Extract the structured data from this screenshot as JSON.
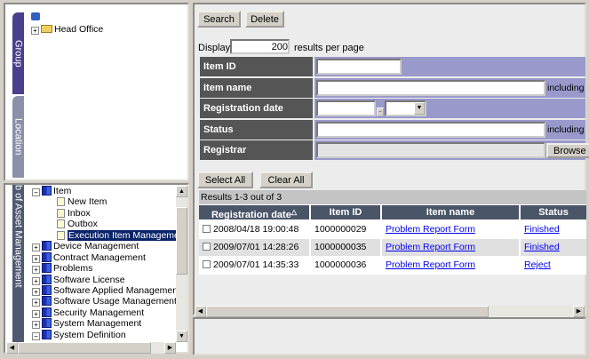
{
  "left": {
    "tabs": [
      "Group",
      "Location",
      "b of Asset Management"
    ],
    "group_tree": {
      "root_icon": "network-computer-icon",
      "items": [
        {
          "label": "Head Office",
          "icon": "folder-icon",
          "expanded": false
        }
      ]
    },
    "menu_tree": [
      {
        "label": "Item",
        "level": 0,
        "expanded": true
      },
      {
        "label": "New Item",
        "level": 1
      },
      {
        "label": "Inbox",
        "level": 1
      },
      {
        "label": "Outbox",
        "level": 1
      },
      {
        "label": "Execution Item Management",
        "level": 1,
        "selected": true
      },
      {
        "label": "Device Management",
        "level": 0
      },
      {
        "label": "Contract Management",
        "level": 0
      },
      {
        "label": "Problems",
        "level": 0
      },
      {
        "label": "Software License",
        "level": 0
      },
      {
        "label": "Software Applied Management",
        "level": 0
      },
      {
        "label": "Software Usage Management",
        "level": 0
      },
      {
        "label": "Security Management",
        "level": 0
      },
      {
        "label": "System Management",
        "level": 0
      },
      {
        "label": "System Definition",
        "level": 0,
        "expanded": true
      }
    ]
  },
  "toolbar": {
    "search": "Search",
    "delete": "Delete"
  },
  "display": {
    "prefix": "Display",
    "value": "200",
    "suffix": "results per page"
  },
  "form": {
    "item_id": "Item ID",
    "item_name": "Item name",
    "reg_date": "Registration date",
    "status": "Status",
    "registrar": "Registrar",
    "including": "including",
    "browse": "Browse"
  },
  "actions": {
    "select_all": "Select All",
    "clear_all": "Clear All"
  },
  "results": {
    "summary": "Results 1-3 out of 3",
    "columns": [
      "Registration date",
      "Item ID",
      "Item name",
      "Status"
    ],
    "sort_indicator": "△",
    "rows": [
      {
        "date": "2008/04/18 19:00:48",
        "id": "1000000029",
        "name": "Problem Report Form",
        "status": "Finished"
      },
      {
        "date": "2009/07/01 14:28:26",
        "id": "1000000035",
        "name": "Problem Report Form",
        "status": "Finished"
      },
      {
        "date": "2009/07/01 14:35:33",
        "id": "1000000036",
        "name": "Problem Report Form",
        "status": "Reject"
      }
    ]
  },
  "colors": {
    "group_tab": "#4a3f8c",
    "location_tab": "#8a90a8",
    "label_bg": "#555555",
    "value_bg": "#9999cc",
    "header_bg": "#4a5568",
    "selected": "#0a246a"
  }
}
